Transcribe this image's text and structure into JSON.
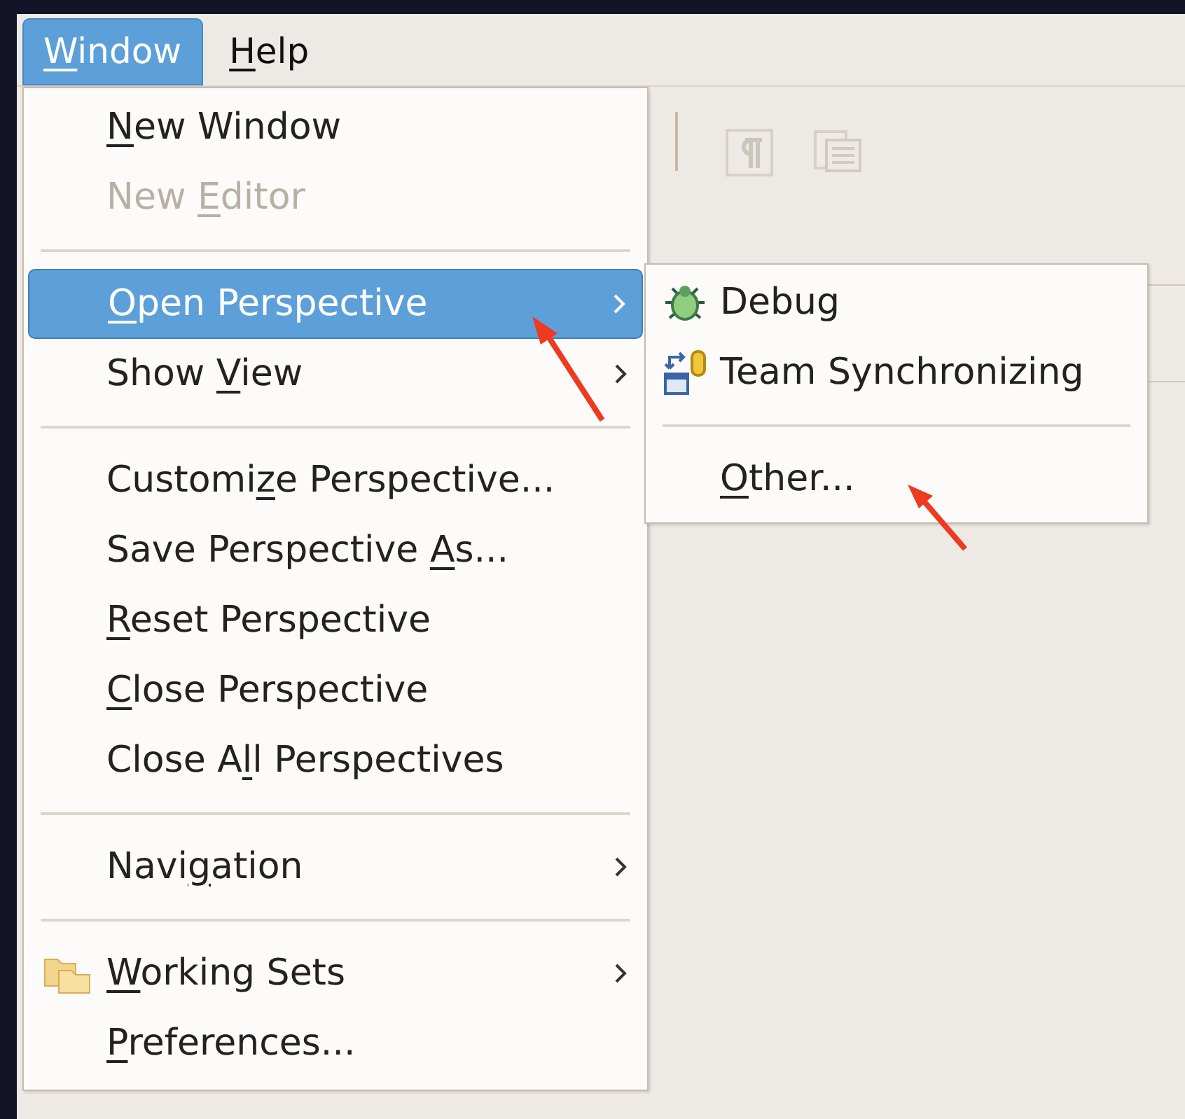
{
  "menubar": [
    {
      "label": "Window",
      "selected": true
    },
    {
      "label": "Help",
      "selected": false
    }
  ],
  "window_menu": [
    {
      "kind": "item",
      "label": "New Window",
      "disabled": false,
      "selected": false
    },
    {
      "kind": "item",
      "label": "New Editor",
      "disabled": true,
      "selected": false
    },
    {
      "kind": "separator"
    },
    {
      "kind": "submenu",
      "label": "Open Perspective",
      "disabled": false,
      "selected": true
    },
    {
      "kind": "submenu",
      "label": "Show View",
      "disabled": false,
      "selected": false
    },
    {
      "kind": "separator"
    },
    {
      "kind": "item",
      "label": "Customize Perspective...",
      "disabled": false,
      "selected": false
    },
    {
      "kind": "item",
      "label": "Save Perspective As...",
      "disabled": false,
      "selected": false
    },
    {
      "kind": "item",
      "label": "Reset Perspective",
      "disabled": false,
      "selected": false
    },
    {
      "kind": "item",
      "label": "Close Perspective",
      "disabled": false,
      "selected": false
    },
    {
      "kind": "item",
      "label": "Close All Perspectives",
      "disabled": false,
      "selected": false
    },
    {
      "kind": "separator"
    },
    {
      "kind": "submenu",
      "label": "Navigation",
      "disabled": false,
      "selected": false
    },
    {
      "kind": "separator"
    },
    {
      "kind": "submenu",
      "label": "Working Sets",
      "disabled": false,
      "selected": false
    },
    {
      "kind": "item",
      "label": "Preferences...",
      "disabled": false,
      "selected": false
    }
  ],
  "perspective_submenu": [
    {
      "kind": "item",
      "label": "Debug",
      "selected": false
    },
    {
      "kind": "item",
      "label": "Team Synchronizing",
      "selected": false
    },
    {
      "kind": "separator"
    },
    {
      "kind": "item",
      "label": "Other...",
      "selected": false
    }
  ]
}
